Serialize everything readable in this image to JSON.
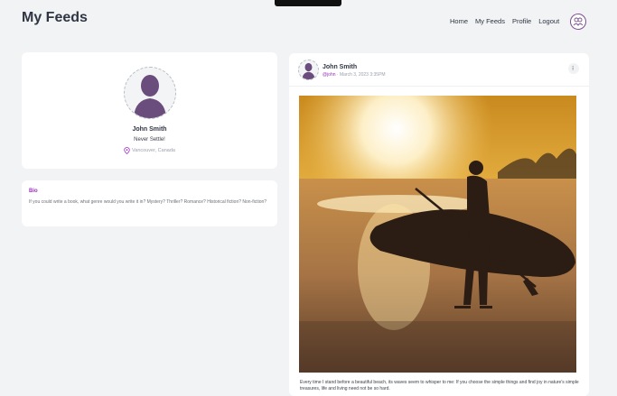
{
  "header": {
    "title": "My Feeds",
    "nav": [
      "Home",
      "My Feeds",
      "Profile",
      "Logout"
    ]
  },
  "profile": {
    "name": "John Smith",
    "tagline": "Never Settle!",
    "location": "Vancouver, Canada"
  },
  "bio": {
    "heading": "Bio",
    "text": "If you could write a book, what genre would you write it in? Mystery? Thriller? Romance? Historical fiction? Non-fiction?"
  },
  "post": {
    "author": "John Smith",
    "handle": "@john",
    "date": "March 3, 2023 3:35PM",
    "more_icon": "ellipsis-icon",
    "image_desc": "surfer-sunset-photo",
    "caption": "Every time I stand before a beautiful beach, its waves seem to whisper to me: If you choose the simple things and find joy in nature's simple treasures, life and living need not be so hard."
  },
  "colors": {
    "accent": "#9b2fc0",
    "avatar": "#6a4c7d",
    "background": "#f2f3f5"
  }
}
